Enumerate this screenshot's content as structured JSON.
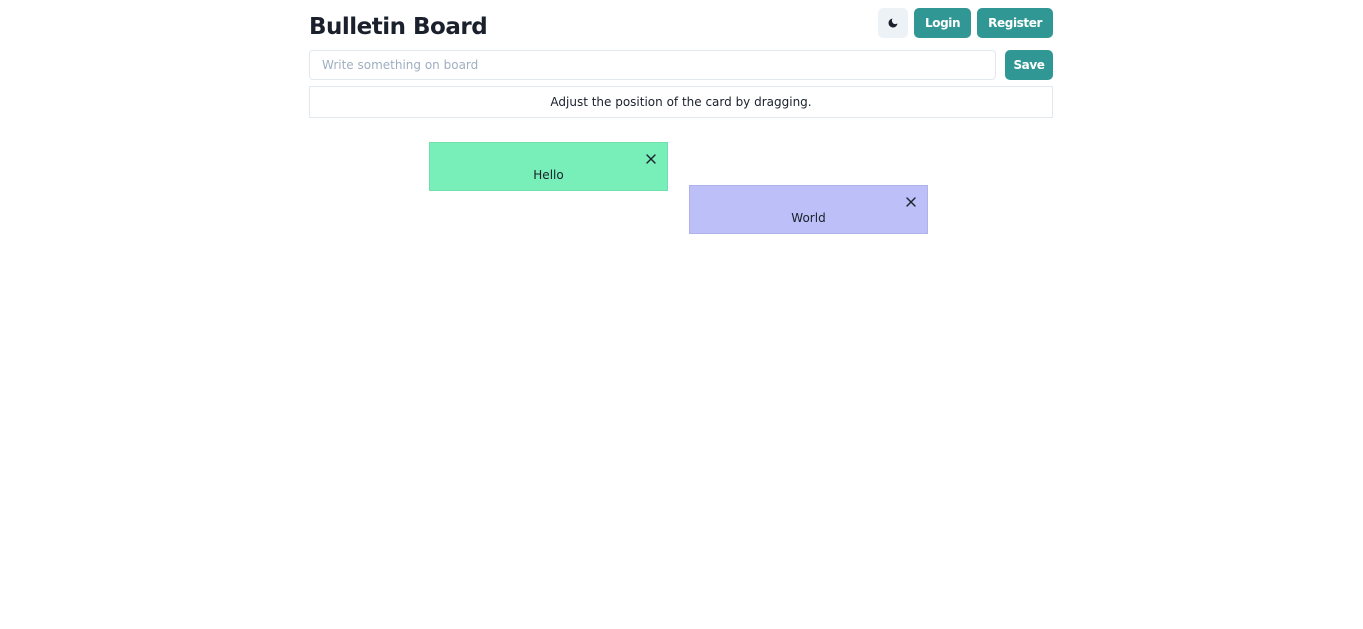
{
  "header": {
    "title": "Bulletin Board",
    "theme_toggle_icon": "moon-icon",
    "login_label": "Login",
    "register_label": "Register"
  },
  "composer": {
    "placeholder": "Write something on board",
    "value": "",
    "save_label": "Save"
  },
  "hint": "Adjust the position of the card by dragging.",
  "cards": [
    {
      "text": "Hello",
      "color": "#78efb8",
      "close_icon": "close-icon"
    },
    {
      "text": "World",
      "color": "#bcbff8",
      "close_icon": "close-icon"
    }
  ],
  "colors": {
    "accent": "#319795",
    "icon_button_bg": "#edf2f7",
    "border": "#e2e8f0"
  }
}
